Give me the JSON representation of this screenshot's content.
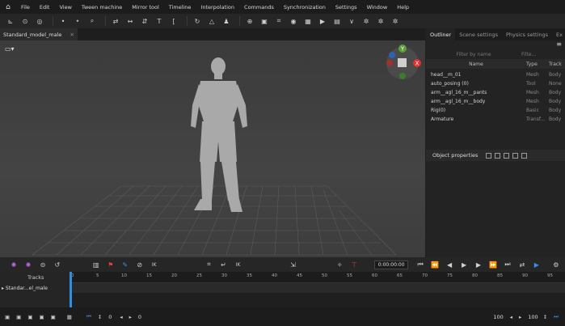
{
  "menu": [
    "File",
    "Edit",
    "View",
    "Tween machine",
    "Mirror tool",
    "Timeline",
    "Interpolation",
    "Commands",
    "Synchronization",
    "Settings",
    "Window",
    "Help"
  ],
  "doc_tab": "Standard_model_male",
  "panel_tabs": [
    "Outliner",
    "Scene settings",
    "Physics settings",
    "Ex"
  ],
  "filters": {
    "name": "Filter by name",
    "type": "Filte..."
  },
  "columns": {
    "name": "Name",
    "type": "Type",
    "track": "Track"
  },
  "outliner": [
    {
      "name": "head__m_01",
      "type": "Mesh",
      "track": "Body"
    },
    {
      "name": "auto_posing (0)",
      "type": "Tool",
      "track": "None"
    },
    {
      "name": "arm__agl_16_m__pants",
      "type": "Mesh",
      "track": "Body"
    },
    {
      "name": "arm__agl_16_m__body",
      "type": "Mesh",
      "track": "Body"
    },
    {
      "name": "Rig(0)",
      "type": "Basic",
      "track": "Body"
    },
    {
      "name": "Armature",
      "type": "Transf...",
      "track": "Body"
    }
  ],
  "object_properties": "Object properties",
  "gizmo": {
    "y": "Y",
    "x": "X"
  },
  "ik_label": "IK",
  "timecode": "0:00:00:00",
  "tracks_label": "Tracks",
  "track_name": "Standar...el_male",
  "ruler_ticks": [
    "0",
    "5",
    "10",
    "15",
    "20",
    "25",
    "30",
    "35",
    "40",
    "45",
    "50",
    "55",
    "60",
    "65",
    "70",
    "75",
    "80",
    "85",
    "90",
    "95"
  ],
  "status": {
    "start": "0",
    "current": "0",
    "end": "100",
    "range": "100"
  }
}
